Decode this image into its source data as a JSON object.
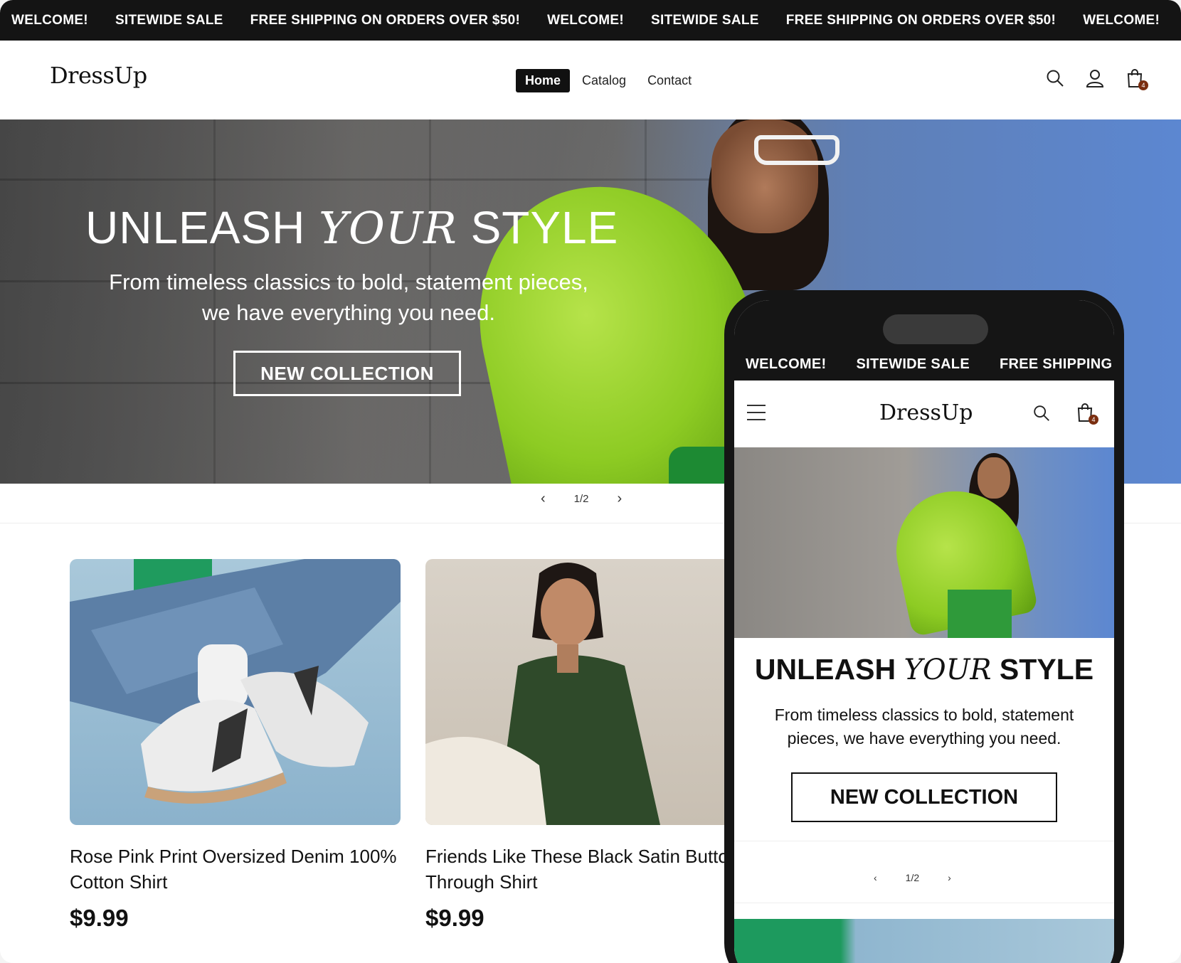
{
  "announcement": {
    "items": [
      "WELCOME!",
      "SITEWIDE SALE",
      "FREE SHIPPING ON ORDERS OVER $50!",
      "WELCOME!",
      "SITEWIDE SALE",
      "FREE SHIPPING ON ORDERS OVER $50!",
      "WELCOME!"
    ]
  },
  "header": {
    "logo": "DressUp",
    "nav": [
      "Home",
      "Catalog",
      "Contact"
    ],
    "active_nav": "Home",
    "cart_count": "4"
  },
  "hero": {
    "title_pre": "UNLEASH ",
    "title_em": "YOUR",
    "title_post": " STYLE",
    "subtitle": "From timeless classics to bold, statement pieces, we have everything you need.",
    "cta": "NEW COLLECTION",
    "slide_counter": "1/2"
  },
  "products": [
    {
      "title": "Rose Pink Print Oversized Denim 100% Cotton Shirt",
      "price": "$9.99"
    },
    {
      "title": "Friends Like These Black Satin Button Through Shirt",
      "price": "$9.99"
    }
  ],
  "mobile": {
    "announcement": [
      "WELCOME!",
      "SITEWIDE SALE",
      "FREE SHIPPING"
    ],
    "logo": "DressUp",
    "cart_count": "4",
    "title_pre": "UNLEASH ",
    "title_em": "YOUR",
    "title_post": " STYLE",
    "subtitle": "From timeless classics to bold, statement pieces, we have everything you need.",
    "cta": "NEW COLLECTION",
    "slide_counter": "1/2"
  },
  "colors": {
    "announcement_bg": "#141414",
    "badge": "#7a2e10",
    "jacket": "#8dcb23"
  }
}
